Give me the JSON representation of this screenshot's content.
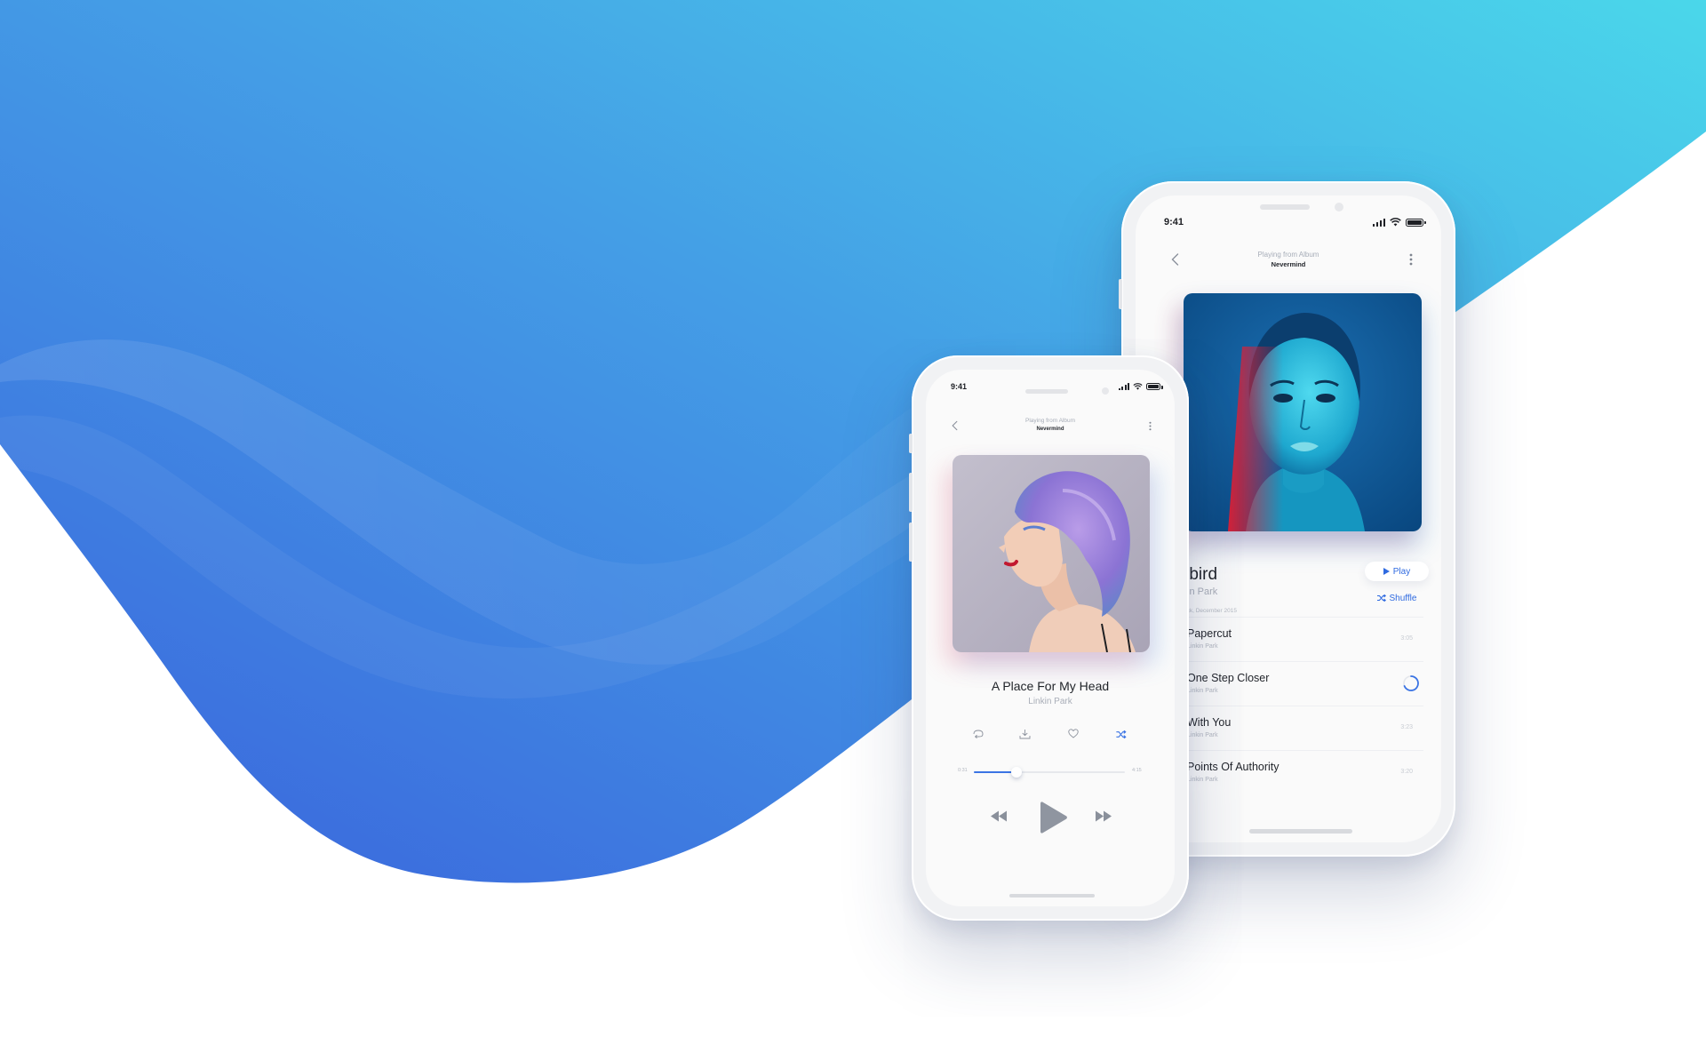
{
  "colors": {
    "gradient_start": "#3d6fdf",
    "gradient_mid": "#449ee6",
    "gradient_end": "#4ad6e9",
    "accent": "#3b74e4",
    "text_dark": "#1f2228",
    "text_muted": "#a9aeb8"
  },
  "back_phone": {
    "status_time": "9:41",
    "header_subtitle": "Playing from Album",
    "header_title": "Nevermind",
    "album_title": "rbird",
    "album_artist": "in Park",
    "album_meta": "ock, December 2015",
    "play_label": "Play",
    "shuffle_label": "Shuffle",
    "icons": [
      "back-chevron-icon",
      "more-vertical-icon",
      "play-icon",
      "shuffle-icon",
      "loading-spinner-icon"
    ],
    "songs": [
      {
        "title": "Papercut",
        "artist": "Linkin Park",
        "time": "3:05"
      },
      {
        "title": "One Step Closer",
        "artist": "Linkin Park",
        "time": ""
      },
      {
        "title": "With You",
        "artist": "Linkin Park",
        "time": "3:23"
      },
      {
        "title": "Points Of Authority",
        "artist": "Linkin Park",
        "time": "3:20"
      }
    ]
  },
  "front_phone": {
    "status_time": "9:41",
    "header_subtitle": "Playing from Album",
    "header_title": "Nevermind",
    "track_title": "A Place For My Head",
    "track_artist": "Linkin Park",
    "elapsed": "0:31",
    "duration": "4:15",
    "progress": 0.28,
    "icons": [
      "back-chevron-icon",
      "more-vertical-icon",
      "repeat-icon",
      "download-icon",
      "heart-icon",
      "shuffle-icon",
      "rewind-icon",
      "play-icon",
      "fast-forward-icon"
    ]
  }
}
